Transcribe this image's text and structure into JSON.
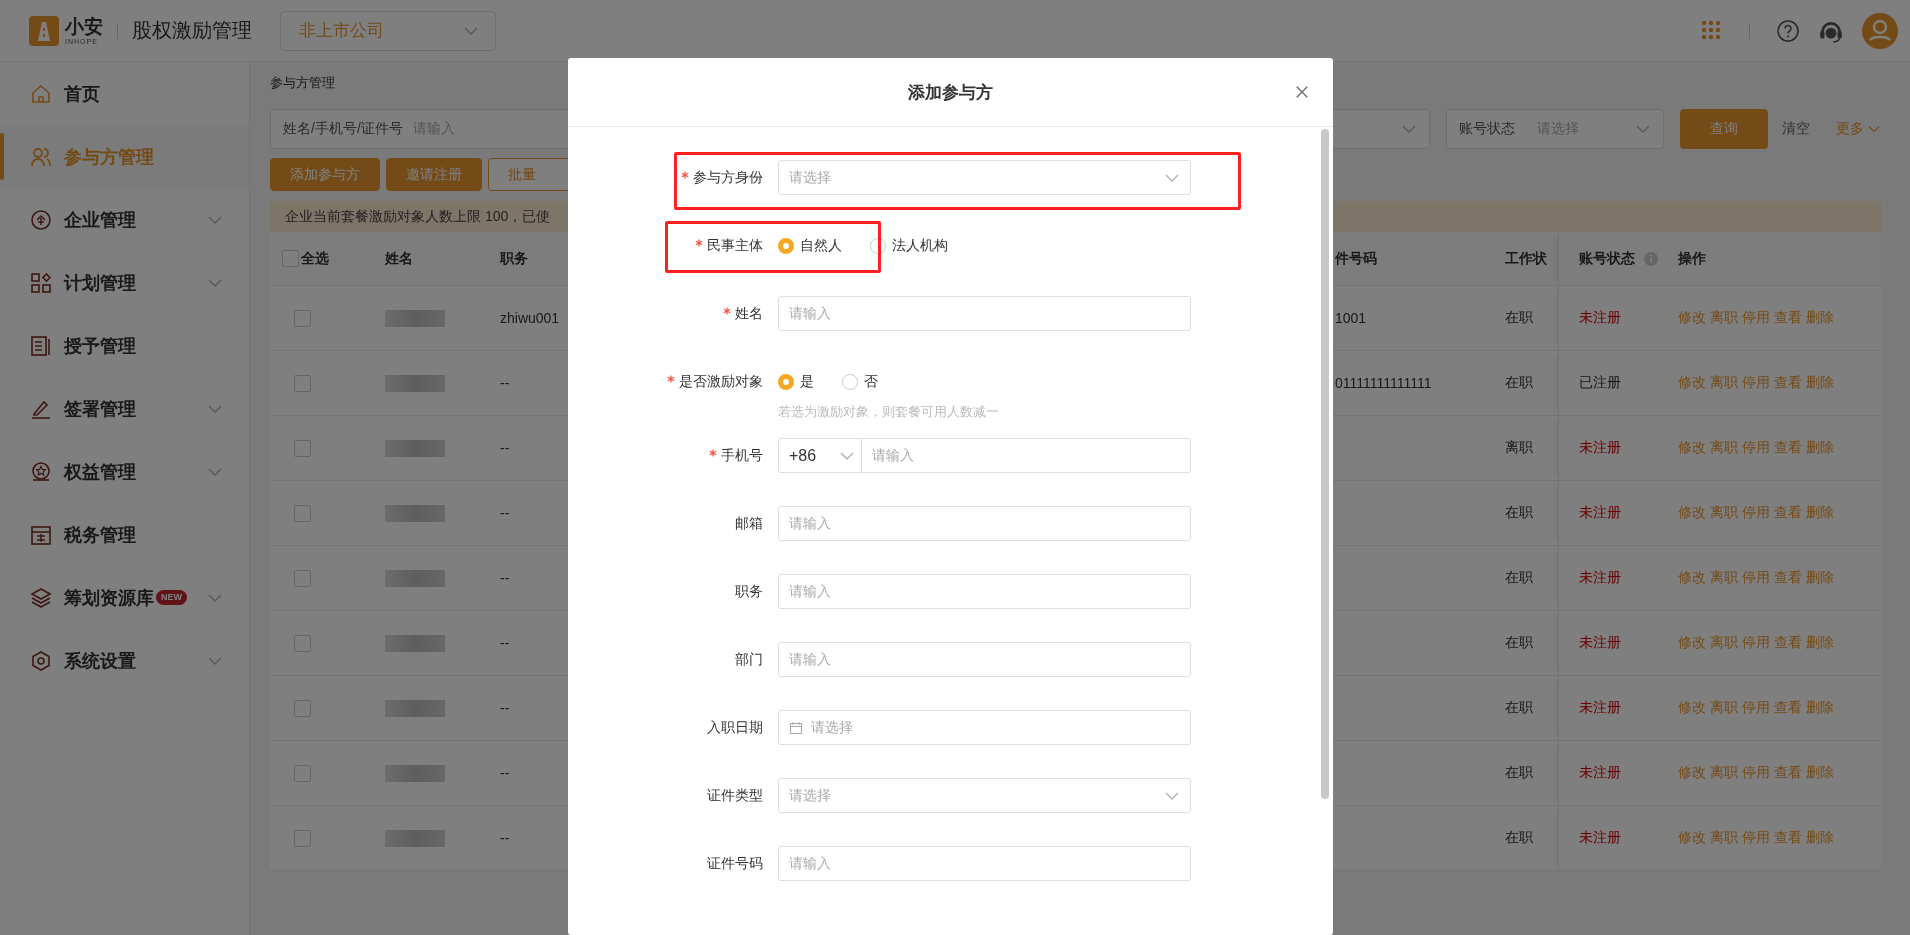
{
  "header": {
    "logo": {
      "name": "小安",
      "sub": "INHOPE"
    },
    "app_title": "股权激励管理",
    "company_select": {
      "value": "非上市公司"
    }
  },
  "sidebar": {
    "items": [
      {
        "label": "首页",
        "kind": "home",
        "selected": false,
        "expandable": false
      },
      {
        "label": "参与方管理",
        "kind": "people",
        "selected": true,
        "expandable": false
      },
      {
        "label": "企业管理",
        "kind": "company",
        "selected": false,
        "expandable": true
      },
      {
        "label": "计划管理",
        "kind": "grid",
        "selected": false,
        "expandable": true
      },
      {
        "label": "授予管理",
        "kind": "book",
        "selected": false,
        "expandable": false
      },
      {
        "label": "签署管理",
        "kind": "pen",
        "selected": false,
        "expandable": true
      },
      {
        "label": "权益管理",
        "kind": "medal",
        "selected": false,
        "expandable": true
      },
      {
        "label": "税务管理",
        "kind": "tax",
        "selected": false,
        "expandable": false
      },
      {
        "label": "筹划资源库",
        "kind": "layers",
        "selected": false,
        "expandable": true,
        "badge": "NEW"
      },
      {
        "label": "系统设置",
        "kind": "settings",
        "selected": false,
        "expandable": true
      }
    ]
  },
  "breadcrumb": "参与方管理",
  "filters": {
    "search": {
      "label": "姓名/手机号/证件号",
      "placeholder": "请输入"
    },
    "account_status": {
      "label": "账号状态",
      "placeholder": "请选择"
    },
    "query_button": "查询",
    "clear_link": "清空",
    "more_link": "更多"
  },
  "actions": [
    {
      "label": "添加参与方",
      "kind": "primary"
    },
    {
      "label": "邀请注册",
      "kind": "primary"
    },
    {
      "label": "批量",
      "kind": "outline"
    }
  ],
  "notice": "企业当前套餐激励对象人数上限 100，已使",
  "table": {
    "select_all": {
      "label": "全选",
      "checked": false
    },
    "columns": [
      "姓名",
      "职务",
      "件号码",
      "工作状",
      "账号状态",
      "操作"
    ],
    "rows": [
      {
        "checked": false,
        "job": "zhiwu001",
        "id_number": "1001",
        "work_status": "在职",
        "account_status": "未注册",
        "registered": false,
        "actions": [
          "修改",
          "离职",
          "停用",
          "查看",
          "删除"
        ]
      },
      {
        "checked": false,
        "job": "--",
        "id_number": "01111111111111",
        "work_status": "在职",
        "account_status": "已注册",
        "registered": true,
        "actions": [
          "修改",
          "离职",
          "停用",
          "查看",
          "删除"
        ]
      },
      {
        "checked": false,
        "job": "--",
        "work_status": "离职",
        "account_status": "未注册",
        "registered": false,
        "actions": [
          "修改",
          "离职",
          "停用",
          "查看",
          "删除"
        ]
      },
      {
        "checked": false,
        "job": "--",
        "work_status": "在职",
        "account_status": "未注册",
        "registered": false,
        "actions": [
          "修改",
          "离职",
          "停用",
          "查看",
          "删除"
        ]
      },
      {
        "checked": false,
        "job": "--",
        "work_status": "在职",
        "account_status": "未注册",
        "registered": false,
        "actions": [
          "修改",
          "离职",
          "停用",
          "查看",
          "删除"
        ]
      },
      {
        "checked": false,
        "job": "--",
        "work_status": "在职",
        "account_status": "未注册",
        "registered": false,
        "actions": [
          "修改",
          "离职",
          "停用",
          "查看",
          "删除"
        ]
      },
      {
        "checked": false,
        "job": "--",
        "work_status": "在职",
        "account_status": "未注册",
        "registered": false,
        "actions": [
          "修改",
          "离职",
          "停用",
          "查看",
          "删除"
        ]
      },
      {
        "checked": false,
        "job": "--",
        "work_status": "在职",
        "account_status": "未注册",
        "registered": false,
        "actions": [
          "修改",
          "离职",
          "停用",
          "查看",
          "删除"
        ]
      },
      {
        "checked": false,
        "job": "--",
        "work_status": "在职",
        "account_status": "未注册",
        "registered": false,
        "actions": [
          "修改",
          "离职",
          "停用",
          "查看",
          "删除"
        ]
      }
    ]
  },
  "dialog": {
    "title": "添加参与方",
    "fields": [
      {
        "label": "参与方身份",
        "required": true,
        "kind": "select",
        "placeholder": "请选择",
        "highlighted": true
      },
      {
        "label": "民事主体",
        "required": true,
        "kind": "radio",
        "highlighted": true,
        "options": [
          {
            "label": "自然人",
            "selected": true
          },
          {
            "label": "法人机构",
            "selected": false
          }
        ]
      },
      {
        "label": "姓名",
        "required": true,
        "kind": "input",
        "placeholder": "请输入",
        "highlighted": false
      },
      {
        "label": "是否激励对象",
        "required": true,
        "kind": "radio",
        "highlighted": false,
        "options": [
          {
            "label": "是",
            "selected": true
          },
          {
            "label": "否",
            "selected": false
          }
        ],
        "hint": "若选为激励对象，则套餐可用人数减一"
      },
      {
        "label": "手机号",
        "required": true,
        "kind": "phone",
        "code": "+86",
        "placeholder": "请输入",
        "highlighted": false
      },
      {
        "label": "邮箱",
        "required": false,
        "kind": "input",
        "placeholder": "请输入",
        "highlighted": false
      },
      {
        "label": "职务",
        "required": false,
        "kind": "input",
        "placeholder": "请输入",
        "highlighted": false
      },
      {
        "label": "部门",
        "required": false,
        "kind": "input",
        "placeholder": "请输入",
        "highlighted": false
      },
      {
        "label": "入职日期",
        "required": false,
        "kind": "date",
        "placeholder": "请选择",
        "highlighted": false
      },
      {
        "label": "证件类型",
        "required": false,
        "kind": "select",
        "placeholder": "请选择",
        "highlighted": false
      },
      {
        "label": "证件号码",
        "required": false,
        "kind": "input",
        "placeholder": "请输入",
        "highlighted": false
      }
    ]
  }
}
